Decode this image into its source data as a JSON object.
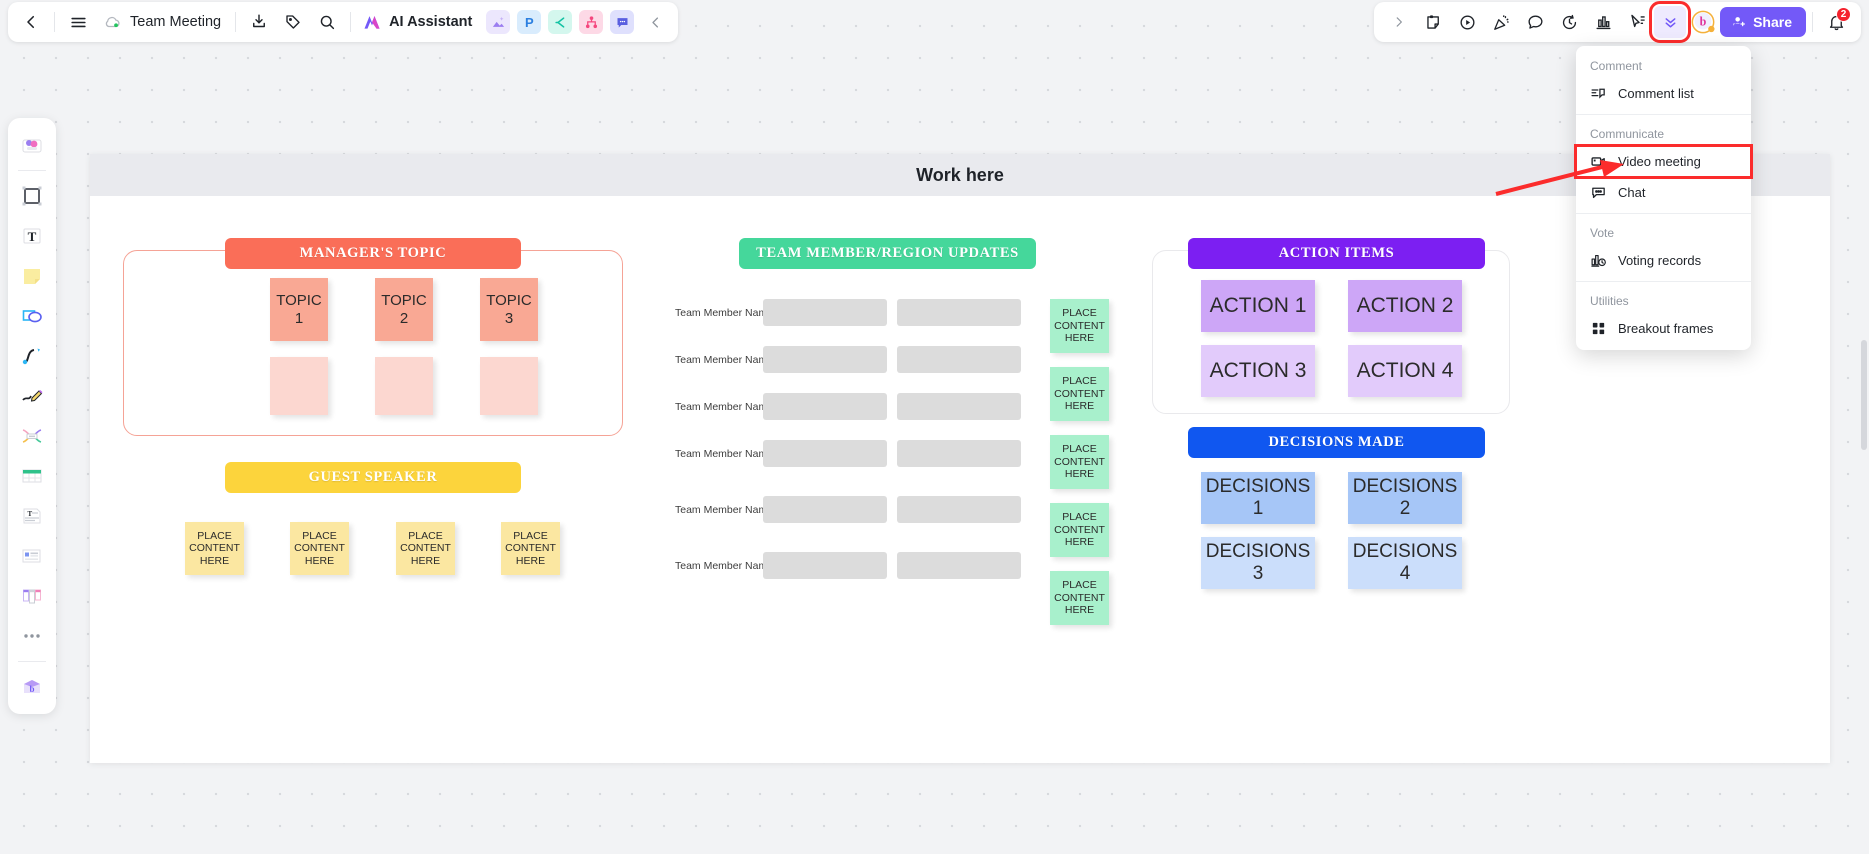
{
  "topbar": {
    "back_icon": "chevron-left-icon",
    "menu_icon": "hamburger-menu-icon",
    "cloud_icon": "cloud-synced-icon",
    "doc_title": "Team Meeting",
    "import_icon": "import-icon",
    "tag_icon": "tag-icon",
    "search_icon": "search-icon",
    "ai_label": "AI Assistant",
    "app_icons": [
      {
        "name": "image-app-icon",
        "glyph": "▲",
        "bg": "#ece7fd",
        "fg": "#8f7bf0"
      },
      {
        "name": "presentation-app-icon",
        "glyph": "P",
        "bg": "#d9ecfd",
        "fg": "#2b7fe0"
      },
      {
        "name": "mindmap-app-icon",
        "glyph": "⊂",
        "bg": "#d4f7ee",
        "fg": "#13c2a3"
      },
      {
        "name": "flowchart-app-icon",
        "glyph": "⑂",
        "bg": "#fdd9e6",
        "fg": "#f5477e"
      },
      {
        "name": "comment-app-icon",
        "glyph": "…",
        "bg": "#dfe0fd",
        "fg": "#5a5fe0"
      }
    ],
    "collapse_icon": "chevron-left-icon",
    "right_expand_icon": "chevron-right-icon",
    "right_icons": [
      {
        "name": "sticker-icon"
      },
      {
        "name": "play-circle-icon"
      },
      {
        "name": "celebrate-icon"
      },
      {
        "name": "chat-bubble-icon"
      },
      {
        "name": "timer-icon"
      },
      {
        "name": "chart-icon"
      },
      {
        "name": "cursor-pointer-icon"
      }
    ],
    "more_chevron_icon": "chevron-double-down-icon",
    "brand_icon": "boardmix-logo-icon",
    "share_label": "Share",
    "share_icon": "person-add-icon",
    "share_color": "#7359f8",
    "bell_icon": "notification-bell-icon",
    "bell_count": "2",
    "badge_color": "#f5222d"
  },
  "left_toolbar": {
    "items": [
      {
        "name": "assets-library-icon",
        "label": "Assets"
      },
      {
        "name": "frame-icon",
        "label": "Frame"
      },
      {
        "name": "text-icon",
        "label": "Text"
      },
      {
        "name": "sticky-note-icon",
        "label": "Sticky note"
      },
      {
        "name": "shape-icon",
        "label": "Shape"
      },
      {
        "name": "connector-icon",
        "label": "Connector"
      },
      {
        "name": "pen-icon",
        "label": "Pen"
      },
      {
        "name": "mindmap-icon",
        "label": "Mind map"
      },
      {
        "name": "table-icon",
        "label": "Table"
      },
      {
        "name": "document-icon",
        "label": "Document"
      },
      {
        "name": "template-icon",
        "label": "Template"
      },
      {
        "name": "kanban-icon",
        "label": "Kanban"
      },
      {
        "name": "more-options-icon",
        "label": "More"
      },
      {
        "name": "ai-toolbox-icon",
        "label": "AI toolbox"
      }
    ]
  },
  "dropdown": {
    "groups": [
      {
        "label": "Comment",
        "items": [
          {
            "label": "Comment list",
            "icon": "comment-list-icon",
            "highlighted": false
          }
        ]
      },
      {
        "label": "Communicate",
        "items": [
          {
            "label": "Video meeting",
            "icon": "video-camera-icon",
            "highlighted": true
          },
          {
            "label": "Chat",
            "icon": "chat-icon",
            "highlighted": false
          }
        ]
      },
      {
        "label": "Vote",
        "items": [
          {
            "label": "Voting records",
            "icon": "voting-records-icon",
            "highlighted": false
          }
        ]
      },
      {
        "label": "Utilities",
        "items": [
          {
            "label": "Breakout frames",
            "icon": "breakout-frames-icon",
            "highlighted": false
          }
        ]
      }
    ],
    "highlight_color": "#fb2c2c"
  },
  "board": {
    "frame_title": "Work here",
    "managers_topic": {
      "banner": "MANAGER'S TOPIC",
      "banner_color": "#fa6e58",
      "outline_color": "#f5a396",
      "topics": [
        "TOPIC\n1",
        "TOPIC\n2",
        "TOPIC\n3"
      ],
      "topic_color": "#f9a894",
      "blank_note_color": "#fcd7d0"
    },
    "guest_speaker": {
      "banner": "GUEST SPEAKER",
      "banner_color": "#fcd43c",
      "notes": [
        "PLACE CONTENT HERE",
        "PLACE CONTENT HERE",
        "PLACE CONTENT HERE",
        "PLACE CONTENT HERE"
      ],
      "note_color": "#fbe7a1"
    },
    "team_updates": {
      "banner": "TEAM MEMBER/REGION UPDATES",
      "banner_color": "#45d79b",
      "row_label": "Team Member Name",
      "row_count": 6,
      "bar_color": "#dcdcdc",
      "side_notes": [
        "PLACE CONTENT HERE",
        "PLACE CONTENT HERE",
        "PLACE CONTENT HERE",
        "PLACE CONTENT HERE",
        "PLACE CONTENT HERE"
      ],
      "side_note_color": "#a8f0cc"
    },
    "action_items": {
      "banner": "ACTION ITEMS",
      "banner_color": "#7c1ff2",
      "outline_color": "#e6e6e6",
      "notes": [
        {
          "label": "ACTION 1",
          "color": "#cda6f7"
        },
        {
          "label": "ACTION 2",
          "color": "#cda6f7"
        },
        {
          "label": "ACTION 3",
          "color": "#e2cbfb"
        },
        {
          "label": "ACTION 4",
          "color": "#e2cbfb"
        }
      ]
    },
    "decisions_made": {
      "banner": "DECISIONS MADE",
      "banner_color": "#1057f0",
      "notes": [
        {
          "label": "DECISIONS 1",
          "color": "#a6c6f7"
        },
        {
          "label": "DECISIONS 2",
          "color": "#a6c6f7"
        },
        {
          "label": "DECISIONS 3",
          "color": "#cbdefb"
        },
        {
          "label": "DECISIONS 4",
          "color": "#cbdefb"
        }
      ]
    }
  }
}
